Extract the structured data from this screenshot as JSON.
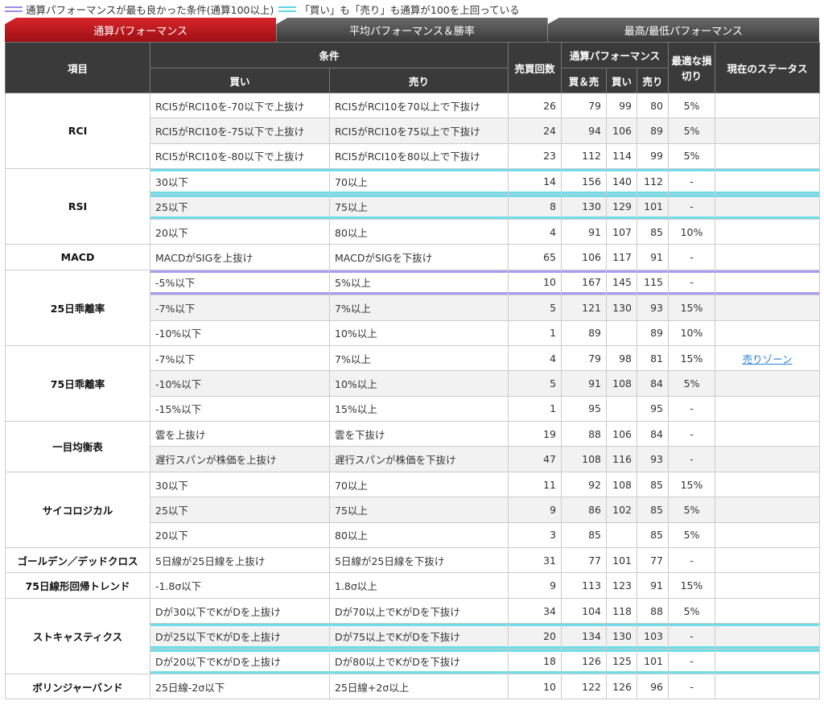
{
  "legend": {
    "purple_label": "通算パフォーマンスが最も良かった条件(通算100以上)",
    "cyan_label": "「買い」も「売り」も通算が100を上回っている"
  },
  "tabs": [
    {
      "label": "通算パフォーマンス",
      "active": true
    },
    {
      "label": "平均パフォーマンス＆勝率",
      "active": false
    },
    {
      "label": "最高/最低パフォーマンス",
      "active": false
    }
  ],
  "header": {
    "item": "項目",
    "condition": "条件",
    "buy": "買い",
    "sell": "売り",
    "trades": "売買回数",
    "total_perf": "通算パフォーマンス",
    "both": "買＆売",
    "perf_buy": "買い",
    "perf_sell": "売り",
    "stoploss": "最適な損切り",
    "status": "現在のステータス"
  },
  "colors": {
    "tab_active": "#c0171d",
    "tab_inactive": "#4a4a4a",
    "header_bg": "#3a3a3a",
    "highlight_cyan": "#6fdde9",
    "highlight_purple": "#a99cf0"
  },
  "groups": [
    {
      "name": "RCI",
      "rows": [
        {
          "buy": "RCI5がRCI10を-70以下で上抜け",
          "sell": "RCI5がRCI10を70以上で下抜け",
          "n": "26",
          "both": "79",
          "b": "99",
          "s": "80",
          "sl": "5%",
          "st": ""
        },
        {
          "buy": "RCI5がRCI10を-75以下で上抜け",
          "sell": "RCI5がRCI10を75以上で下抜け",
          "n": "24",
          "both": "94",
          "b": "106",
          "s": "89",
          "sl": "5%",
          "st": ""
        },
        {
          "buy": "RCI5がRCI10を-80以下で上抜け",
          "sell": "RCI5がRCI10を80以上で下抜け",
          "n": "23",
          "both": "112",
          "b": "114",
          "s": "99",
          "sl": "5%",
          "st": ""
        }
      ]
    },
    {
      "name": "RSI",
      "rows": [
        {
          "buy": "30以下",
          "sell": "70以上",
          "n": "14",
          "both": "156",
          "b": "140",
          "s": "112",
          "sl": "-",
          "st": "",
          "hl": "cyan"
        },
        {
          "buy": "25以下",
          "sell": "75以上",
          "n": "8",
          "both": "130",
          "b": "129",
          "s": "101",
          "sl": "-",
          "st": "",
          "hl": "cyan"
        },
        {
          "buy": "20以下",
          "sell": "80以上",
          "n": "4",
          "both": "91",
          "b": "107",
          "s": "85",
          "sl": "10%",
          "st": ""
        }
      ]
    },
    {
      "name": "MACD",
      "rows": [
        {
          "buy": "MACDがSIGを上抜け",
          "sell": "MACDがSIGを下抜け",
          "n": "65",
          "both": "106",
          "b": "117",
          "s": "91",
          "sl": "-",
          "st": ""
        }
      ]
    },
    {
      "name": "25日乖離率",
      "rows": [
        {
          "buy": "-5%以下",
          "sell": "5%以上",
          "n": "10",
          "both": "167",
          "b": "145",
          "s": "115",
          "sl": "-",
          "st": "",
          "hl": "purple"
        },
        {
          "buy": "-7%以下",
          "sell": "7%以上",
          "n": "5",
          "both": "121",
          "b": "130",
          "s": "93",
          "sl": "15%",
          "st": ""
        },
        {
          "buy": "-10%以下",
          "sell": "10%以上",
          "n": "1",
          "both": "89",
          "b": "",
          "s": "89",
          "sl": "10%",
          "st": ""
        }
      ]
    },
    {
      "name": "75日乖離率",
      "rows": [
        {
          "buy": "-7%以下",
          "sell": "7%以上",
          "n": "4",
          "both": "79",
          "b": "98",
          "s": "81",
          "sl": "15%",
          "st": "売りゾーン"
        },
        {
          "buy": "-10%以下",
          "sell": "10%以上",
          "n": "5",
          "both": "91",
          "b": "108",
          "s": "84",
          "sl": "5%",
          "st": ""
        },
        {
          "buy": "-15%以下",
          "sell": "15%以上",
          "n": "1",
          "both": "95",
          "b": "",
          "s": "95",
          "sl": "-",
          "st": ""
        }
      ]
    },
    {
      "name": "一目均衡表",
      "rows": [
        {
          "buy": "雲を上抜け",
          "sell": "雲を下抜け",
          "n": "19",
          "both": "88",
          "b": "106",
          "s": "84",
          "sl": "-",
          "st": ""
        },
        {
          "buy": "遅行スパンが株価を上抜け",
          "sell": "遅行スパンが株価を下抜け",
          "n": "47",
          "both": "108",
          "b": "116",
          "s": "93",
          "sl": "-",
          "st": ""
        }
      ]
    },
    {
      "name": "サイコロジカル",
      "rows": [
        {
          "buy": "30以下",
          "sell": "70以上",
          "n": "11",
          "both": "92",
          "b": "108",
          "s": "85",
          "sl": "15%",
          "st": ""
        },
        {
          "buy": "25以下",
          "sell": "75以上",
          "n": "9",
          "both": "86",
          "b": "102",
          "s": "85",
          "sl": "5%",
          "st": ""
        },
        {
          "buy": "20以下",
          "sell": "80以上",
          "n": "3",
          "both": "85",
          "b": "",
          "s": "85",
          "sl": "5%",
          "st": ""
        }
      ]
    },
    {
      "name": "ゴールデン／デッドクロス",
      "rows": [
        {
          "buy": "5日線が25日線を上抜け",
          "sell": "5日線が25日線を下抜け",
          "n": "31",
          "both": "77",
          "b": "101",
          "s": "77",
          "sl": "-",
          "st": ""
        }
      ]
    },
    {
      "name": "75日線形回帰トレンド",
      "rows": [
        {
          "buy": "-1.8σ以下",
          "sell": "1.8σ以上",
          "n": "9",
          "both": "113",
          "b": "123",
          "s": "91",
          "sl": "15%",
          "st": ""
        }
      ]
    },
    {
      "name": "ストキャスティクス",
      "rows": [
        {
          "buy": "Dが30以下でKがDを上抜け",
          "sell": "Dが70以上でKがDを下抜け",
          "n": "34",
          "both": "104",
          "b": "118",
          "s": "88",
          "sl": "5%",
          "st": ""
        },
        {
          "buy": "Dが25以下でKがDを上抜け",
          "sell": "Dが75以上でKがDを下抜け",
          "n": "20",
          "both": "134",
          "b": "130",
          "s": "103",
          "sl": "-",
          "st": "",
          "hl": "cyan"
        },
        {
          "buy": "Dが20以下でKがDを上抜け",
          "sell": "Dが80以上でKがDを下抜け",
          "n": "18",
          "both": "126",
          "b": "125",
          "s": "101",
          "sl": "-",
          "st": "",
          "hl": "cyan"
        }
      ]
    },
    {
      "name": "ボリンジャーバンド",
      "rows": [
        {
          "buy": "25日線-2σ以下",
          "sell": "25日線+2σ以上",
          "n": "10",
          "both": "122",
          "b": "126",
          "s": "96",
          "sl": "-",
          "st": ""
        }
      ]
    }
  ]
}
